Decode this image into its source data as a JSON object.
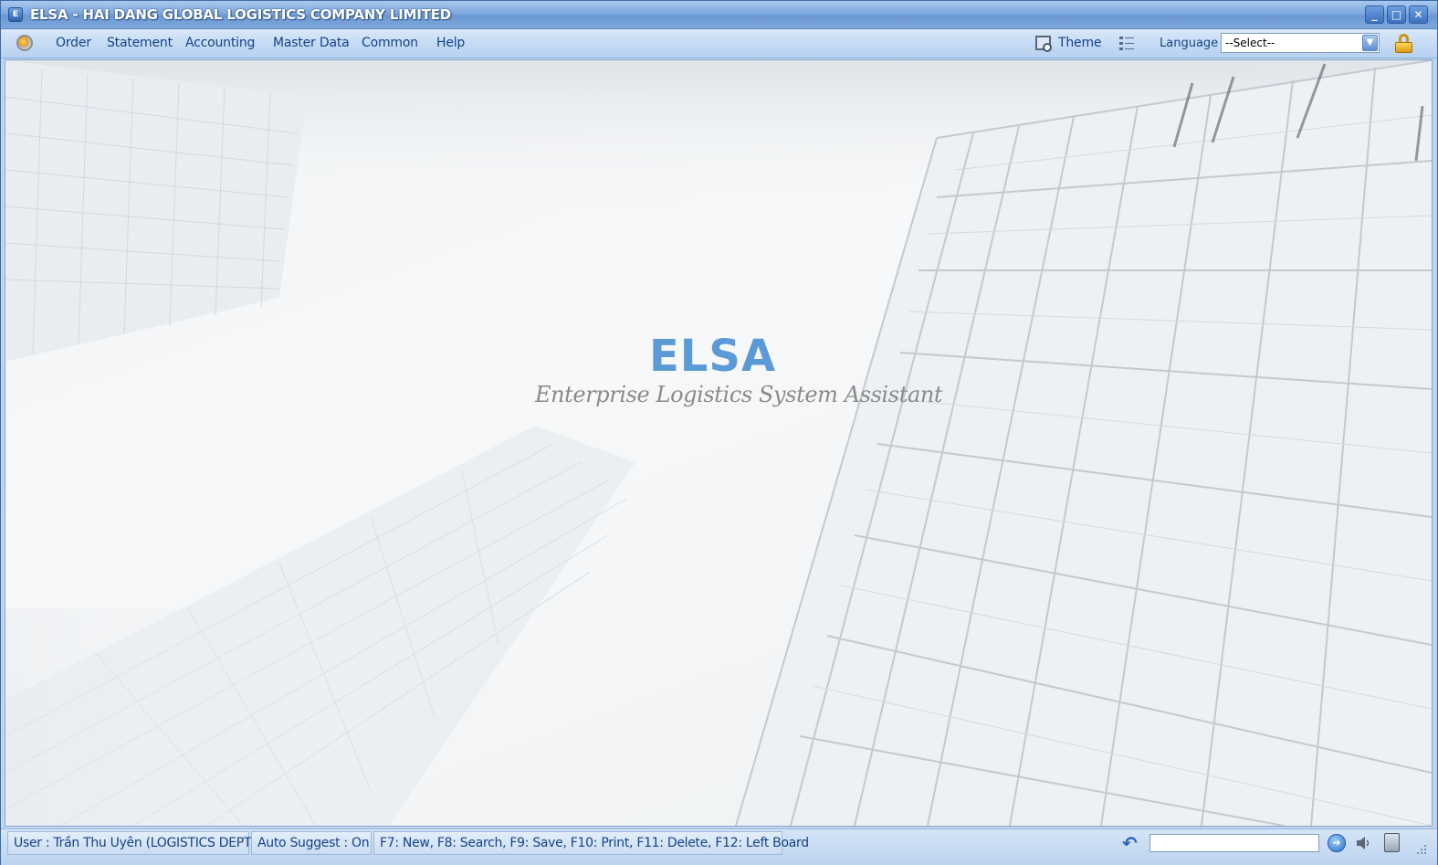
{
  "window": {
    "title": "ELSA - HAI DANG GLOBAL LOGISTICS COMPANY LIMITED",
    "controls": {
      "minimize": "_",
      "maximize": "□",
      "close": "✕"
    }
  },
  "menu": {
    "items": [
      {
        "label": "Order"
      },
      {
        "label": "Statement"
      },
      {
        "label": "Accounting"
      },
      {
        "label": "Master Data"
      },
      {
        "label": "Common"
      },
      {
        "label": "Help"
      }
    ],
    "theme_label": "Theme",
    "language_label": "Language",
    "language_select": {
      "selected": "--Select--"
    }
  },
  "splash": {
    "brand": "ELSA",
    "tagline": "Enterprise Logistics System Assistant"
  },
  "status": {
    "user": "User : Trần Thu Uyên (LOGISTICS DEPT)",
    "auto_suggest": "Auto Suggest : On",
    "shortcuts": "F7: New, F8: Search, F9: Save, F10: Print, F11: Delete, F12: Left Board"
  },
  "colors": {
    "title_bar": "#7ea8de",
    "menu_text": "#15428b",
    "brand": "#5a9ad6"
  },
  "icons": [
    "app-icon",
    "menu-orb-icon",
    "theme-icon",
    "list-icon",
    "chevron-down-icon",
    "lock-icon",
    "undo-icon",
    "go-icon",
    "sound-icon",
    "calculator-icon",
    "resize-grip-icon"
  ]
}
